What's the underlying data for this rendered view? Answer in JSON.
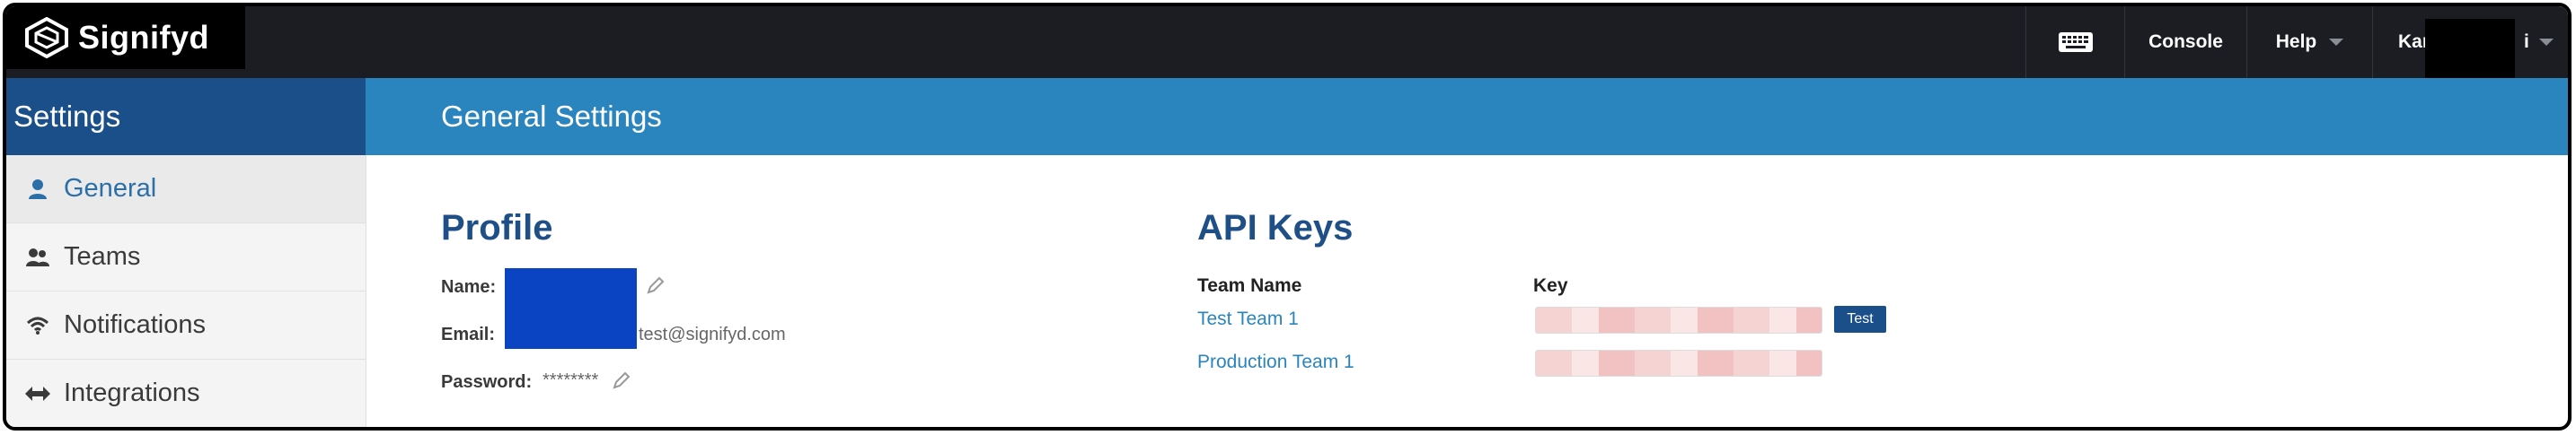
{
  "app": {
    "brand": "Signifyd",
    "accent_color": "#2a84be",
    "nav_dark": "#1b1d22"
  },
  "topnav": {
    "keyboard_icon": "keyboard-icon",
    "console_label": "Console",
    "help_label": "Help",
    "user_label_start": "Kar",
    "user_label_end": "i"
  },
  "sidebar": {
    "title": "Settings",
    "items": [
      {
        "label": "General",
        "icon": "user-icon",
        "active": true
      },
      {
        "label": "Teams",
        "icon": "team-icon",
        "active": false
      },
      {
        "label": "Notifications",
        "icon": "wifi-icon",
        "active": false
      },
      {
        "label": "Integrations",
        "icon": "integration-icon",
        "active": false
      }
    ]
  },
  "main": {
    "title": "General Settings",
    "profile": {
      "heading": "Profile",
      "name_label": "Name:",
      "email_label": "Email:",
      "email_value": "test@signifyd.com",
      "password_label": "Password:",
      "password_value": "********"
    },
    "api_keys": {
      "heading": "API Keys",
      "col_team": "Team Name",
      "col_key": "Key",
      "rows": [
        {
          "team": "Test Team 1",
          "button": "Test"
        },
        {
          "team": "Production Team 1"
        }
      ]
    }
  }
}
